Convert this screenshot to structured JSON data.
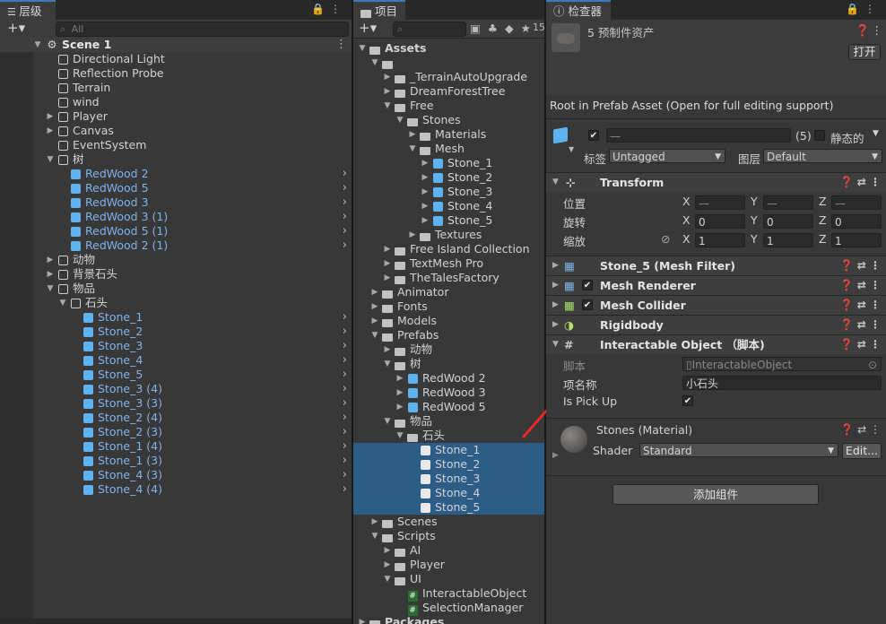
{
  "hierarchy": {
    "tab_label": "层级",
    "search_placeholder": "All",
    "scene": "Scene 1",
    "items": [
      {
        "label": "Directional Light"
      },
      {
        "label": "Reflection Probe"
      },
      {
        "label": "Terrain"
      },
      {
        "label": "wind"
      },
      {
        "label": "Player"
      },
      {
        "label": "Canvas"
      },
      {
        "label": "EventSystem"
      },
      {
        "label": "树"
      },
      {
        "label": "RedWood 2"
      },
      {
        "label": "RedWood 5"
      },
      {
        "label": "RedWood 3"
      },
      {
        "label": "RedWood 3 (1)"
      },
      {
        "label": "RedWood 5 (1)"
      },
      {
        "label": "RedWood 2 (1)"
      },
      {
        "label": "动物"
      },
      {
        "label": "背景石头"
      },
      {
        "label": "物品"
      },
      {
        "label": "石头"
      },
      {
        "label": "Stone_1"
      },
      {
        "label": "Stone_2"
      },
      {
        "label": "Stone_3"
      },
      {
        "label": "Stone_4"
      },
      {
        "label": "Stone_5"
      },
      {
        "label": "Stone_3 (4)"
      },
      {
        "label": "Stone_3 (3)"
      },
      {
        "label": "Stone_2 (4)"
      },
      {
        "label": "Stone_2 (3)"
      },
      {
        "label": "Stone_1 (4)"
      },
      {
        "label": "Stone_1 (3)"
      },
      {
        "label": "Stone_4 (3)"
      },
      {
        "label": "Stone_4 (4)"
      }
    ]
  },
  "project": {
    "tab_label": "项目",
    "hidden_count": "15",
    "items": [
      {
        "label": "Assets"
      },
      {
        "label": ""
      },
      {
        "label": "_TerrainAutoUpgrade"
      },
      {
        "label": "DreamForestTree"
      },
      {
        "label": "Free"
      },
      {
        "label": "Stones"
      },
      {
        "label": "Materials"
      },
      {
        "label": "Mesh"
      },
      {
        "label": "Stone_1"
      },
      {
        "label": "Stone_2"
      },
      {
        "label": "Stone_3"
      },
      {
        "label": "Stone_4"
      },
      {
        "label": "Stone_5"
      },
      {
        "label": "Textures"
      },
      {
        "label": "Free Island Collection"
      },
      {
        "label": "TextMesh Pro"
      },
      {
        "label": "TheTalesFactory"
      },
      {
        "label": "Animator"
      },
      {
        "label": "Fonts"
      },
      {
        "label": "Models"
      },
      {
        "label": "Prefabs"
      },
      {
        "label": "动物"
      },
      {
        "label": "树"
      },
      {
        "label": "RedWood 2"
      },
      {
        "label": "RedWood 3"
      },
      {
        "label": "RedWood 5"
      },
      {
        "label": "物品"
      },
      {
        "label": "石头"
      },
      {
        "label": "Stone_1"
      },
      {
        "label": "Stone_2"
      },
      {
        "label": "Stone_3"
      },
      {
        "label": "Stone_4"
      },
      {
        "label": "Stone_5"
      },
      {
        "label": "Scenes"
      },
      {
        "label": "Scripts"
      },
      {
        "label": "AI"
      },
      {
        "label": "Player"
      },
      {
        "label": "UI"
      },
      {
        "label": "InteractableObject"
      },
      {
        "label": "SelectionManager"
      },
      {
        "label": "Packages"
      }
    ]
  },
  "inspector": {
    "tab_label": "检查器",
    "asset_title": "5 预制件资产",
    "open_button": "打开",
    "notice": "Root in Prefab Asset (Open for full editing support)",
    "name_field": "—",
    "count": "(5)",
    "static_label": "静态的",
    "tag_label": "标签",
    "tag_value": "Untagged",
    "layer_label": "图层",
    "layer_value": "Default",
    "transform": {
      "title": "Transform",
      "position_label": "位置",
      "rotation_label": "旋转",
      "scale_label": "缩放",
      "x": "X",
      "y": "Y",
      "z": "Z",
      "pos": [
        "—",
        "—",
        "—"
      ],
      "rot": [
        "0",
        "0",
        "0"
      ],
      "scl": [
        "1",
        "1",
        "1"
      ]
    },
    "components": [
      {
        "title": "Stone_5 (Mesh Filter)"
      },
      {
        "title": "Mesh Renderer"
      },
      {
        "title": "Mesh Collider"
      },
      {
        "title": "Rigidbody"
      },
      {
        "title": "Interactable Object （脚本)"
      }
    ],
    "script_label": "脚本",
    "script_value": "InteractableObject",
    "item_name_label": "项名称",
    "item_name_value": "小石头",
    "pickup_label": "Is Pick Up",
    "material_title": "Stones (Material)",
    "shader_label": "Shader",
    "shader_value": "Standard",
    "edit_button": "Edit...",
    "add_component": "添加组件"
  },
  "colors": {
    "selection": "#2c5d87",
    "prefab_blue": "#7fb3ec",
    "arrow": "#e8282a"
  }
}
